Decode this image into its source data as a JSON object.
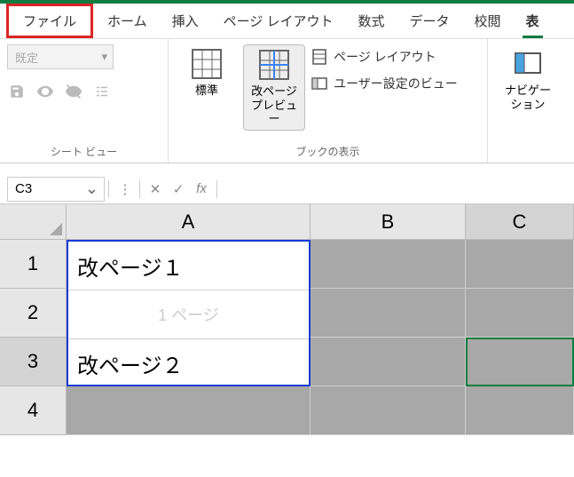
{
  "tabs": {
    "file": "ファイル",
    "home": "ホーム",
    "insert": "挿入",
    "pagelayout": "ページ レイアウト",
    "formulas": "数式",
    "data": "データ",
    "review": "校閲",
    "view": "表"
  },
  "ribbon": {
    "sheetview": {
      "combo": "既定",
      "label": "シート ビュー"
    },
    "workbookviews": {
      "normal": "標準",
      "pagebreak_l1": "改ページ",
      "pagebreak_l2": "プレビュー",
      "pagelayout": "ページ レイアウト",
      "custom": "ユーザー設定のビュー",
      "label": "ブックの表示"
    },
    "nav": {
      "l1": "ナビゲー",
      "l2": "ション"
    }
  },
  "formulaBar": {
    "nameBox": "C3",
    "fx": "fx"
  },
  "grid": {
    "cols": [
      "A",
      "B",
      "C"
    ],
    "rows": [
      "1",
      "2",
      "3",
      "4"
    ],
    "a1": "改ページ１",
    "a2_watermark": "1 ページ",
    "a3": "改ページ２",
    "activeCell": "C3"
  }
}
